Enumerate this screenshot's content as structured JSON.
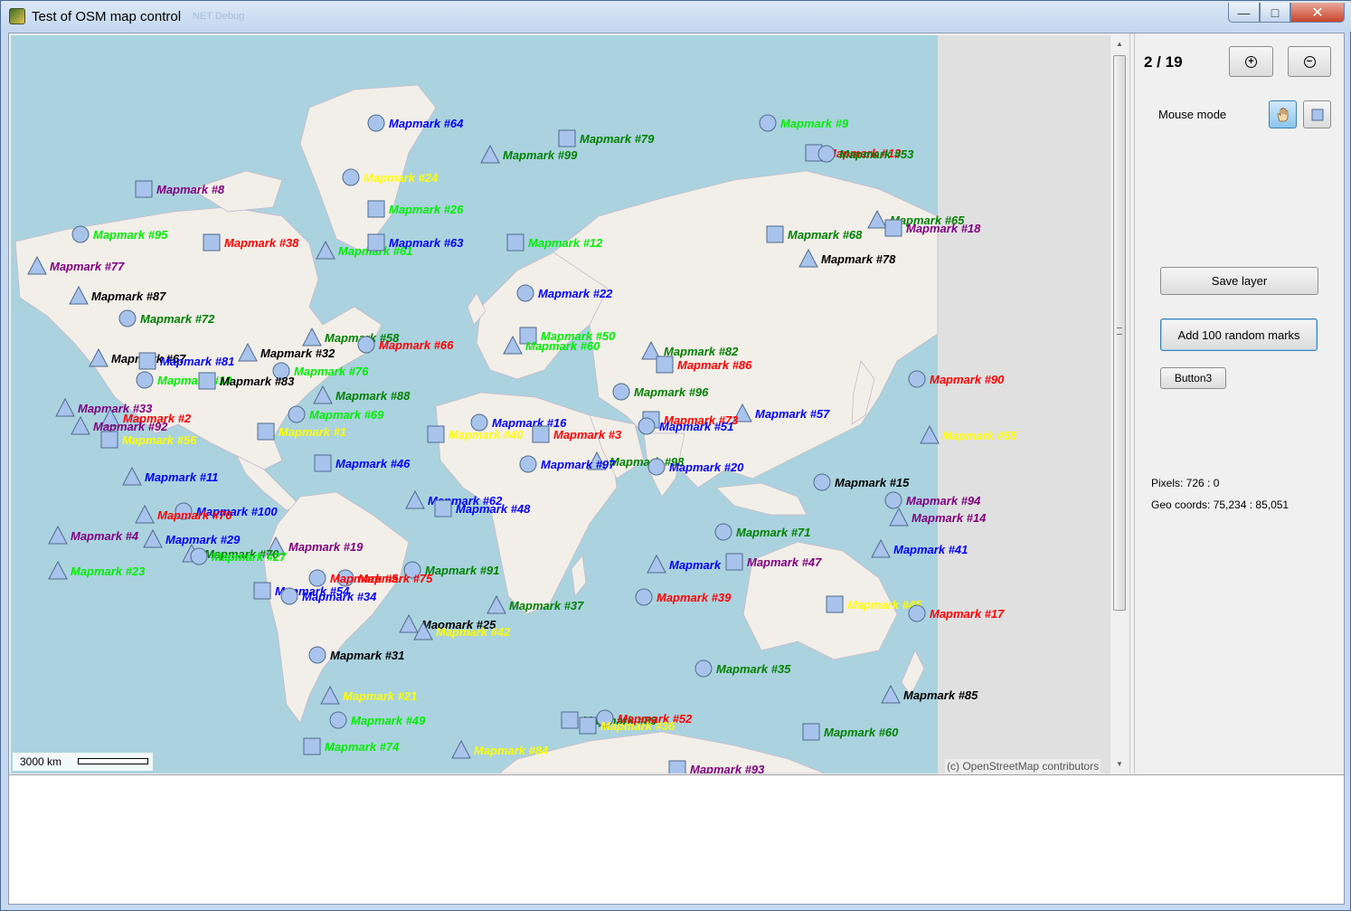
{
  "window": {
    "title": "Test of OSM map control",
    "faded_menu": "NET Debug",
    "min": "—",
    "max": "□",
    "close": "✕"
  },
  "panel": {
    "page_indicator": "2 / 19",
    "zoom_in_icon": "+",
    "zoom_out_icon": "−",
    "mouse_mode_label": "Mouse mode",
    "mouse_mode_selected": "pan",
    "save_layer": "Save layer",
    "add_random": "Add 100 random marks",
    "button3": "Button3",
    "pixels": "Pixels: 726 : 0",
    "geo_coords": "Geo coords: 75,234 : 85,051"
  },
  "map": {
    "scale_label": "3000 km",
    "attribution": "(c) OpenStreetMap contributors",
    "colors": {
      "ocean": "#aad3df",
      "land": "#f2efe9",
      "marker_fill": "#a9c4ec",
      "marker_stroke": "#4f6a8c"
    },
    "marks": [
      {
        "text": "Mapmark #64",
        "shape": "circle",
        "color": "#0000ff"
      },
      {
        "text": "Mapmark #9",
        "shape": "circle",
        "color": "#00ee00"
      },
      {
        "text": "Mapmark #79",
        "shape": "square",
        "color": "#008000"
      },
      {
        "text": "Mapmark #99",
        "shape": "triangle",
        "color": "#008000"
      },
      {
        "text": "Mapmark #13",
        "shape": "square",
        "color": "#ff0000"
      },
      {
        "text": "Mapmark #53",
        "shape": "circle",
        "color": "#008000"
      },
      {
        "text": "Mapmark #24",
        "shape": "circle",
        "color": "#ffff00"
      },
      {
        "text": "Mapmark #8",
        "shape": "square",
        "color": "#800080"
      },
      {
        "text": "Mapmark #26",
        "shape": "square",
        "color": "#00ee00"
      },
      {
        "text": "Mapmark #95",
        "shape": "circle",
        "color": "#00ee00"
      },
      {
        "text": "Mapmark #38",
        "shape": "square",
        "color": "#ff0000"
      },
      {
        "text": "Mapmark #61",
        "shape": "triangle",
        "color": "#00ee00"
      },
      {
        "text": "Mapmark #63",
        "shape": "square",
        "color": "#0000ff"
      },
      {
        "text": "Mapmark #12",
        "shape": "square",
        "color": "#00ee00"
      },
      {
        "text": "Mapmark #65",
        "shape": "triangle",
        "color": "#008000"
      },
      {
        "text": "Mapmark #18",
        "shape": "square",
        "color": "#800080"
      },
      {
        "text": "Mapmark #68",
        "shape": "square",
        "color": "#008000"
      },
      {
        "text": "Mapmark #78",
        "shape": "triangle",
        "color": "#000000"
      },
      {
        "text": "Mapmark #77",
        "shape": "triangle",
        "color": "#800080"
      },
      {
        "text": "Mapmark #87",
        "shape": "triangle",
        "color": "#000000"
      },
      {
        "text": "Mapmark #22",
        "shape": "circle",
        "color": "#0000ff"
      },
      {
        "text": "Mapmark #72",
        "shape": "circle",
        "color": "#008000"
      },
      {
        "text": "Mapmark #58",
        "shape": "triangle",
        "color": "#008000"
      },
      {
        "text": "Mapmark #66",
        "shape": "circle",
        "color": "#ff0000"
      },
      {
        "text": "Mapmark #50",
        "shape": "square",
        "color": "#00ee00"
      },
      {
        "text": "Mapmark #60",
        "shape": "triangle",
        "color": "#00ee00"
      },
      {
        "text": "Mapmark #82",
        "shape": "triangle",
        "color": "#008000"
      },
      {
        "text": "Mapmark #67",
        "shape": "triangle",
        "color": "#000000"
      },
      {
        "text": "Mapmark #32",
        "shape": "triangle",
        "color": "#000000"
      },
      {
        "text": "Mapmark #81",
        "shape": "square",
        "color": "#0000ff"
      },
      {
        "text": "Mapmark #86",
        "shape": "square",
        "color": "#ff0000"
      },
      {
        "text": "Mapmark #76",
        "shape": "circle",
        "color": "#00ee00"
      },
      {
        "text": "Mapmark #10",
        "shape": "circle",
        "color": "#00ee00"
      },
      {
        "text": "Mapmark #83",
        "shape": "square",
        "color": "#000000"
      },
      {
        "text": "Mapmark #90",
        "shape": "circle",
        "color": "#ff0000"
      },
      {
        "text": "Mapmark #88",
        "shape": "triangle",
        "color": "#008000"
      },
      {
        "text": "Mapmark #96",
        "shape": "circle",
        "color": "#008000"
      },
      {
        "text": "Mapmark #33",
        "shape": "triangle",
        "color": "#800080"
      },
      {
        "text": "Mapmark #57",
        "shape": "triangle",
        "color": "#0000ff"
      },
      {
        "text": "Mapmark #2",
        "shape": "triangle",
        "color": "#ff0000"
      },
      {
        "text": "Mapmark #69",
        "shape": "circle",
        "color": "#00ee00"
      },
      {
        "text": "Mapmark #92",
        "shape": "triangle",
        "color": "#800080"
      },
      {
        "text": "Mapmark #16",
        "shape": "circle",
        "color": "#0000ff"
      },
      {
        "text": "Mapmark #73",
        "shape": "square",
        "color": "#ff0000"
      },
      {
        "text": "Mapmark #51",
        "shape": "circle",
        "color": "#0000ff"
      },
      {
        "text": "Mapmark #1",
        "shape": "square",
        "color": "#ffff00"
      },
      {
        "text": "Mapmark #40",
        "shape": "square",
        "color": "#ffff00"
      },
      {
        "text": "Mapmark #3",
        "shape": "square",
        "color": "#ff0000"
      },
      {
        "text": "Mapmark #55",
        "shape": "triangle",
        "color": "#ffff00"
      },
      {
        "text": "Mapmark #56",
        "shape": "square",
        "color": "#ffff00"
      },
      {
        "text": "Mapmark #98",
        "shape": "triangle",
        "color": "#008000"
      },
      {
        "text": "Mapmark #46",
        "shape": "square",
        "color": "#0000ff"
      },
      {
        "text": "Mapmark #97",
        "shape": "circle",
        "color": "#0000ff"
      },
      {
        "text": "Mapmark #20",
        "shape": "circle",
        "color": "#0000ff"
      },
      {
        "text": "Mapmark #11",
        "shape": "triangle",
        "color": "#0000ff"
      },
      {
        "text": "Mapmark #15",
        "shape": "circle",
        "color": "#000000"
      },
      {
        "text": "Mapmark #62",
        "shape": "triangle",
        "color": "#0000ff"
      },
      {
        "text": "Mapmark #94",
        "shape": "circle",
        "color": "#800080"
      },
      {
        "text": "Mapmark #48",
        "shape": "square",
        "color": "#0000ff"
      },
      {
        "text": "Mapmark #100",
        "shape": "circle",
        "color": "#0000ff"
      },
      {
        "text": "Mapmark #76",
        "shape": "triangle",
        "color": "#ff0000"
      },
      {
        "text": "Mapmark #14",
        "shape": "triangle",
        "color": "#800080"
      },
      {
        "text": "Mapmark #71",
        "shape": "circle",
        "color": "#008000"
      },
      {
        "text": "Mapmark #4",
        "shape": "triangle",
        "color": "#800080"
      },
      {
        "text": "Mapmark #29",
        "shape": "triangle",
        "color": "#0000ff"
      },
      {
        "text": "Mapmark #19",
        "shape": "triangle",
        "color": "#800080"
      },
      {
        "text": "Mapmark #41",
        "shape": "triangle",
        "color": "#0000ff"
      },
      {
        "text": "Mapmark #70",
        "shape": "triangle",
        "color": "#008000"
      },
      {
        "text": "Mapmark #27",
        "shape": "circle",
        "color": "#00ee00"
      },
      {
        "text": "Mapmark",
        "shape": "triangle",
        "color": "#0000ff"
      },
      {
        "text": "Mapmark #47",
        "shape": "square",
        "color": "#800080"
      },
      {
        "text": "Mapmark #23",
        "shape": "triangle",
        "color": "#00ee00"
      },
      {
        "text": "Mapmark #91",
        "shape": "circle",
        "color": "#008000"
      },
      {
        "text": "Mapmark #75",
        "shape": "circle",
        "color": "#ff0000"
      },
      {
        "text": "Mapmark #5",
        "shape": "circle",
        "color": "#ff0000"
      },
      {
        "text": "Mapmark #54",
        "shape": "square",
        "color": "#0000ff"
      },
      {
        "text": "Mapmark #34",
        "shape": "circle",
        "color": "#0000ff"
      },
      {
        "text": "Mapmark #37",
        "shape": "triangle",
        "color": "#008000"
      },
      {
        "text": "Mapmark #39",
        "shape": "circle",
        "color": "#ff0000"
      },
      {
        "text": "Mapmark #45",
        "shape": "square",
        "color": "#ffff00"
      },
      {
        "text": "Mapmark #17",
        "shape": "circle",
        "color": "#ff0000"
      },
      {
        "text": "Maomark #25",
        "shape": "triangle",
        "color": "#000000"
      },
      {
        "text": "Mapmark #42",
        "shape": "triangle",
        "color": "#ffff00"
      },
      {
        "text": "Mapmark #31",
        "shape": "circle",
        "color": "#000000"
      },
      {
        "text": "Mapmark #35",
        "shape": "circle",
        "color": "#008000"
      },
      {
        "text": "Mapmark #21",
        "shape": "triangle",
        "color": "#ffff00"
      },
      {
        "text": "Mapmark #85",
        "shape": "triangle",
        "color": "#000000"
      },
      {
        "text": "Mapmark #49",
        "shape": "circle",
        "color": "#00ee00"
      },
      {
        "text": "Mapmark #89",
        "shape": "square",
        "color": "#008000"
      },
      {
        "text": "Mapmark #52",
        "shape": "circle",
        "color": "#ff0000"
      },
      {
        "text": "Mapmark #36",
        "shape": "square",
        "color": "#ffff00"
      },
      {
        "text": "Mapmark #60",
        "shape": "square",
        "color": "#008000"
      },
      {
        "text": "Mapmark #74",
        "shape": "square",
        "color": "#00ee00"
      },
      {
        "text": "Mapmark #84",
        "shape": "triangle",
        "color": "#ffff00"
      },
      {
        "text": "Mapmark #93",
        "shape": "square",
        "color": "#800080"
      }
    ]
  }
}
